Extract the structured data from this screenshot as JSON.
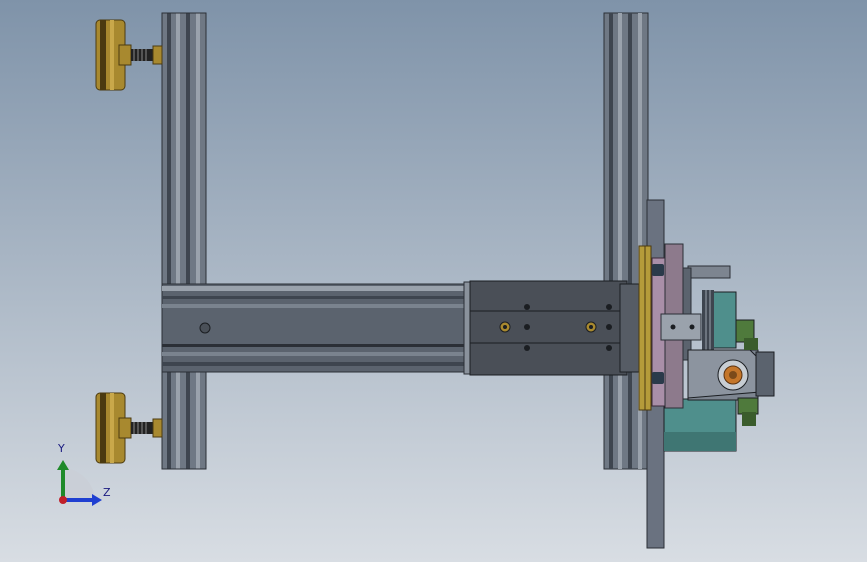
{
  "viewport": {
    "background_top": "#7f93a9",
    "background_bottom": "#d8dde3",
    "colors": {
      "frame_dark": "#3e454f",
      "frame_mid": "#6f7884",
      "frame_light": "#9aa2ac",
      "actuator_body": "#4a4f57",
      "brass": "#a8892f",
      "brass_dark": "#4b3a10",
      "teal": "#4f8f8c",
      "pink_plate": "#a98fa8",
      "green_part": "#4f7a3c",
      "orange_bearing": "#c4762a"
    }
  },
  "model_parts": [
    "left-upright-profile",
    "right-upright-profile",
    "top-leveling-foot",
    "bottom-leveling-foot",
    "horizontal-crossbar",
    "linear-actuator-block",
    "vertical-mount-plate",
    "gripper-assembly",
    "teal-motor-housing"
  ],
  "triad": {
    "y_label": "Y",
    "z_label": "Z",
    "y_color": "#1f8a2a",
    "z_color": "#1f3fd1",
    "origin_color": "#c0202a"
  }
}
